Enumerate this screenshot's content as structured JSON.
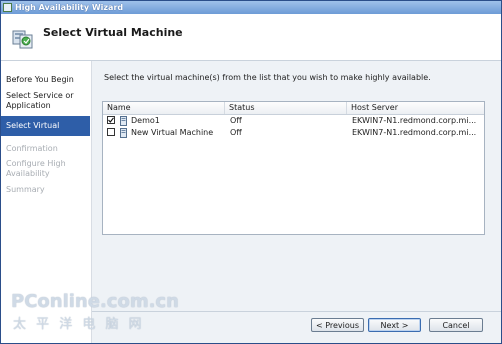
{
  "window": {
    "title": "High Availability Wizard"
  },
  "header": {
    "title": "Select Virtual Machine",
    "icon": "cluster-vm-icon"
  },
  "sidebar": {
    "steps": [
      {
        "label": "Before You Begin",
        "state": "normal"
      },
      {
        "label": "Select Service or Application",
        "state": "normal"
      },
      {
        "label": "Select Virtual Machine",
        "state": "active"
      },
      {
        "label": "Confirmation",
        "state": "disabled"
      },
      {
        "label": "Configure High Availability",
        "state": "disabled"
      },
      {
        "label": "Summary",
        "state": "disabled"
      }
    ]
  },
  "main": {
    "instruction": "Select the virtual machine(s) from the list that you wish to make highly available.",
    "columns": [
      "Name",
      "Status",
      "Host Server"
    ],
    "rows": [
      {
        "checked": true,
        "name": "Demo1",
        "status": "Off",
        "host": "EKWIN7-N1.redmond.corp.mi..."
      },
      {
        "checked": false,
        "name": "New Virtual Machine",
        "status": "Off",
        "host": "EKWIN7-N1.redmond.corp.mi..."
      }
    ]
  },
  "buttons": {
    "previous": "< Previous",
    "next": "Next >",
    "cancel": "Cancel"
  },
  "watermark": {
    "line1": "PConline.com.cn",
    "line2": "太 平 洋 电 脑 网"
  },
  "colors": {
    "accent": "#2e5ea8",
    "titlebar": "#6d9bd6"
  }
}
